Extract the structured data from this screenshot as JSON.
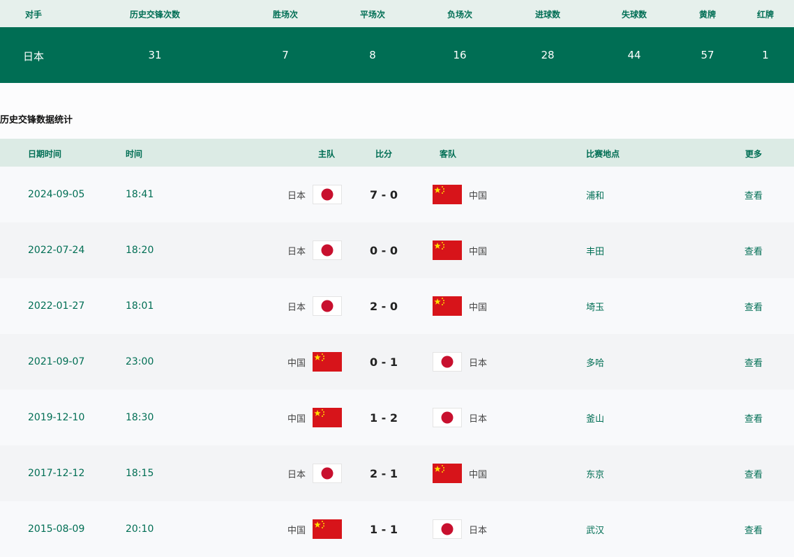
{
  "summary": {
    "headers": [
      "对手",
      "历史交锋次数",
      "胜场次",
      "平场次",
      "负场次",
      "进球数",
      "失球数",
      "黄牌",
      "红牌"
    ],
    "values": [
      "日本",
      "31",
      "7",
      "8",
      "16",
      "28",
      "44",
      "57",
      "1"
    ]
  },
  "section_title": "历史交锋数据统计",
  "match_headers": {
    "date": "日期时间",
    "time": "时间",
    "home": "主队",
    "score": "比分",
    "away": "客队",
    "venue": "比赛地点",
    "more": "更多"
  },
  "flags": {
    "japan_red": "#c8102e",
    "china_red": "#d7141a",
    "china_star": "#ffde00"
  },
  "matches": [
    {
      "date": "2024-09-05",
      "time": "18:41",
      "home": "日本",
      "home_flag": "japan",
      "score": "7 - 0",
      "away": "中国",
      "away_flag": "china",
      "venue": "浦和",
      "more": "查看"
    },
    {
      "date": "2022-07-24",
      "time": "18:20",
      "home": "日本",
      "home_flag": "japan",
      "score": "0 - 0",
      "away": "中国",
      "away_flag": "china",
      "venue": "丰田",
      "more": "查看"
    },
    {
      "date": "2022-01-27",
      "time": "18:01",
      "home": "日本",
      "home_flag": "japan",
      "score": "2 - 0",
      "away": "中国",
      "away_flag": "china",
      "venue": "埼玉",
      "more": "查看"
    },
    {
      "date": "2021-09-07",
      "time": "23:00",
      "home": "中国",
      "home_flag": "china",
      "score": "0 - 1",
      "away": "日本",
      "away_flag": "japan",
      "venue": "多哈",
      "more": "查看"
    },
    {
      "date": "2019-12-10",
      "time": "18:30",
      "home": "中国",
      "home_flag": "china",
      "score": "1 - 2",
      "away": "日本",
      "away_flag": "japan",
      "venue": "釜山",
      "more": "查看"
    },
    {
      "date": "2017-12-12",
      "time": "18:15",
      "home": "日本",
      "home_flag": "japan",
      "score": "2 - 1",
      "away": "中国",
      "away_flag": "china",
      "venue": "东京",
      "more": "查看"
    },
    {
      "date": "2015-08-09",
      "time": "20:10",
      "home": "中国",
      "home_flag": "china",
      "score": "1 - 1",
      "away": "日本",
      "away_flag": "japan",
      "venue": "武汉",
      "more": "查看"
    }
  ]
}
